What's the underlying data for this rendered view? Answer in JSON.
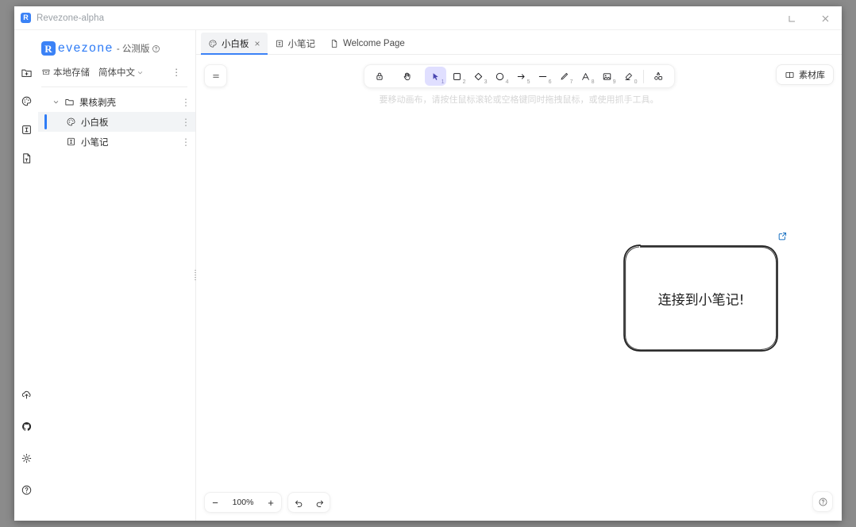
{
  "window": {
    "title": "Revezone-alpha",
    "app_icon": "R",
    "minimize_label": "−",
    "close_label": "×"
  },
  "sidebar": {
    "brand": {
      "logo_letter": "R",
      "name": "evezone",
      "tag": "- 公测版",
      "help_icon": "question-circle-icon"
    },
    "meta": {
      "storage_icon": "archive-icon",
      "storage_label": "本地存储",
      "language_label": "简体中文",
      "language_caret": "chevron-down-icon",
      "more_dots": "⋮"
    },
    "rail_top": [
      {
        "name": "add-folder-icon",
        "title": "新建文件夹"
      },
      {
        "name": "new-board-icon",
        "title": "新建白板"
      },
      {
        "name": "new-note-icon",
        "title": "新建笔记"
      },
      {
        "name": "new-text-file-icon",
        "title": "新建文本"
      }
    ],
    "rail_bottom": [
      {
        "name": "cloud-upload-icon",
        "title": "上传"
      },
      {
        "name": "github-icon",
        "title": "GitHub"
      },
      {
        "name": "settings-gear-icon",
        "title": "设置"
      },
      {
        "name": "help-circle-icon",
        "title": "帮助"
      }
    ],
    "collapse_icon": "collapse-sidebar-icon",
    "tree": [
      {
        "label": "果核剥壳",
        "icon": "folder-icon",
        "level": 1,
        "caret": "chevron-down-icon",
        "selected": false,
        "dots": "⋮"
      },
      {
        "label": "小白板",
        "icon": "board-palette-icon",
        "level": 2,
        "caret": "",
        "selected": true,
        "dots": "⋮"
      },
      {
        "label": "小笔记",
        "icon": "note-icon",
        "level": 2,
        "caret": "",
        "selected": false,
        "dots": "⋮"
      }
    ]
  },
  "tabs": [
    {
      "label": "小白板",
      "icon": "board-palette-icon",
      "active": true,
      "closable": true,
      "close_label": "×"
    },
    {
      "label": "小笔记",
      "icon": "note-icon",
      "active": false,
      "closable": false,
      "close_label": ""
    },
    {
      "label": "Welcome Page",
      "icon": "page-icon",
      "active": false,
      "closable": false,
      "close_label": ""
    }
  ],
  "canvas": {
    "menu_icon": "hamburger-menu-icon",
    "hint": "要移动画布，请按住鼠标滚轮或空格键同时拖拽鼠标，或使用抓手工具。",
    "library_button": {
      "label": "素材库",
      "icon": "library-icon"
    },
    "element": {
      "type": "rounded-rectangle",
      "text": "连接到小笔记!",
      "link_icon": "external-link-icon",
      "link_color": "#1971c2"
    },
    "zoom": {
      "out_label": "−",
      "value": "100%",
      "in_label": "+",
      "undo_icon": "undo-icon",
      "redo_icon": "redo-icon"
    },
    "help_icon": "help-circle-icon"
  },
  "toolbar": {
    "active_tool": "selection",
    "tools": [
      {
        "name": "lock-icon",
        "label": "",
        "shortcut": "",
        "active": false
      },
      {
        "name": "hand-icon",
        "label": "",
        "shortcut": "",
        "active": false
      },
      {
        "name": "selection-icon",
        "label": "",
        "shortcut": "1",
        "active": true
      },
      {
        "name": "rectangle-icon",
        "label": "",
        "shortcut": "2",
        "active": false
      },
      {
        "name": "diamond-icon",
        "label": "",
        "shortcut": "3",
        "active": false
      },
      {
        "name": "ellipse-icon",
        "label": "",
        "shortcut": "4",
        "active": false
      },
      {
        "name": "arrow-icon",
        "label": "",
        "shortcut": "5",
        "active": false
      },
      {
        "name": "line-icon",
        "label": "",
        "shortcut": "6",
        "active": false
      },
      {
        "name": "draw-icon",
        "label": "",
        "shortcut": "7",
        "active": false
      },
      {
        "name": "text-icon",
        "label": "",
        "shortcut": "8",
        "active": false
      },
      {
        "name": "image-icon",
        "label": "",
        "shortcut": "9",
        "active": false
      },
      {
        "name": "eraser-icon",
        "label": "",
        "shortcut": "0",
        "active": false
      },
      {
        "name": "more-tools-icon",
        "label": "",
        "shortcut": "",
        "active": false
      }
    ]
  },
  "colors": {
    "accent": "#3b82f6",
    "tool_active_bg": "#e0dfff",
    "tool_active_fg": "#4a47b1",
    "link_blue": "#1971c2",
    "hint_gray": "#d6d6d6"
  }
}
